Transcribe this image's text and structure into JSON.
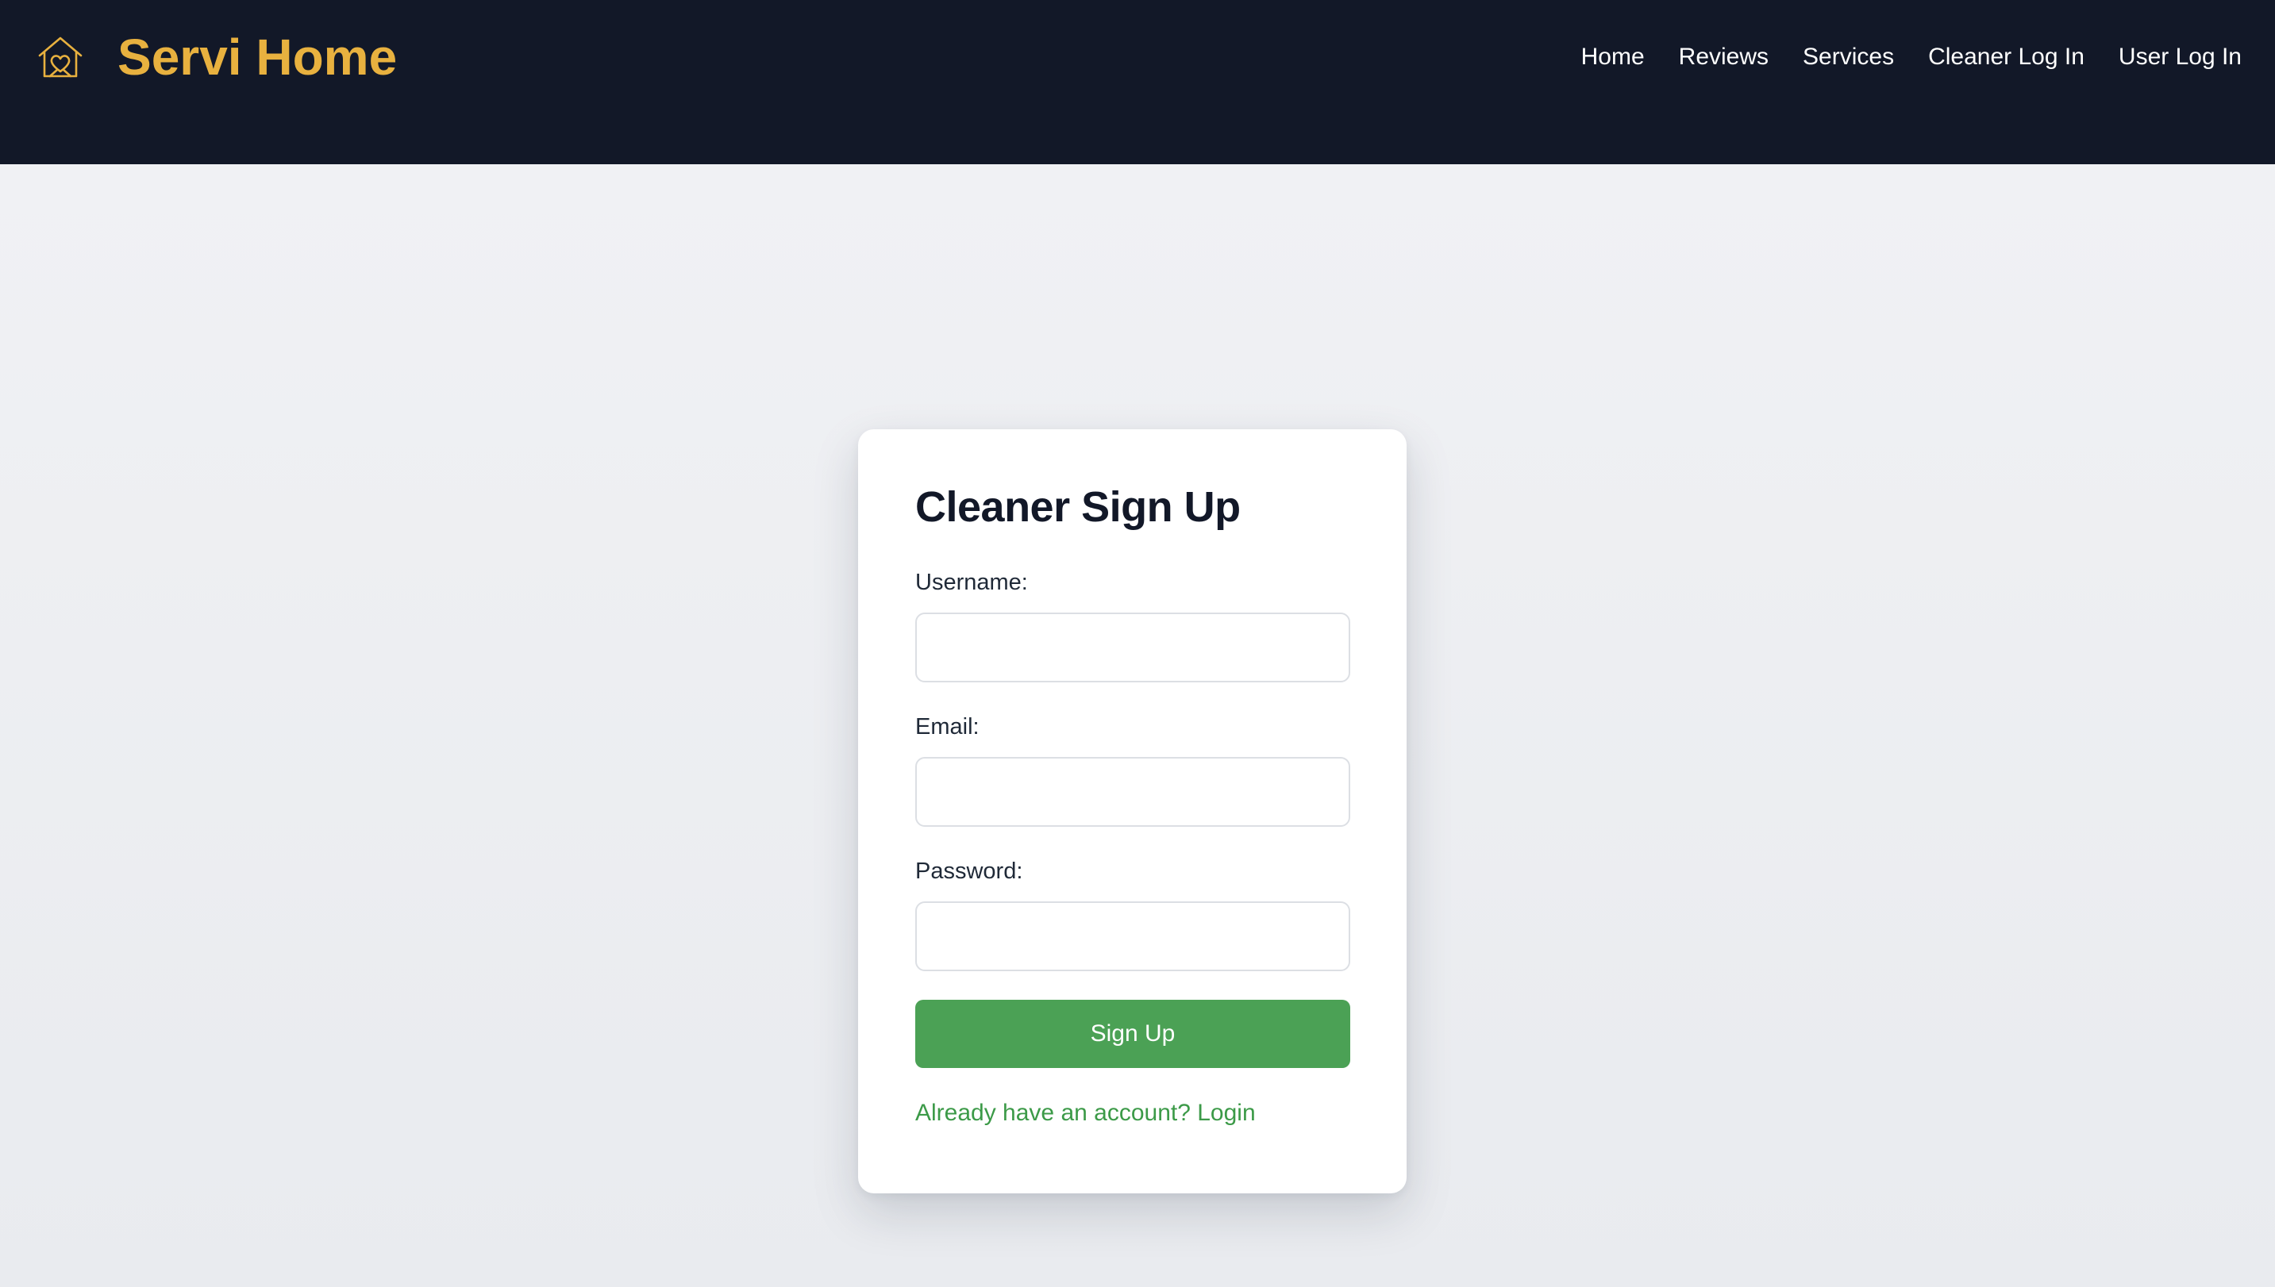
{
  "header": {
    "brand_name": "Servi Home",
    "brand_icon": "house-heart-icon",
    "nav": [
      {
        "label": "Home"
      },
      {
        "label": "Reviews"
      },
      {
        "label": "Services"
      },
      {
        "label": "Cleaner Log In"
      },
      {
        "label": "User Log In"
      }
    ]
  },
  "form": {
    "title": "Cleaner Sign Up",
    "username": {
      "label": "Username:",
      "value": "",
      "placeholder": ""
    },
    "email": {
      "label": "Email:",
      "value": "",
      "placeholder": ""
    },
    "password": {
      "label": "Password:",
      "value": "",
      "placeholder": ""
    },
    "submit_label": "Sign Up",
    "login_link": "Already have an account? Login"
  },
  "colors": {
    "navbar_bg": "#121828",
    "brand_accent": "#e8b13f",
    "primary_button": "#4ba155",
    "link": "#3c9a48",
    "page_bg": "#eceef2"
  }
}
